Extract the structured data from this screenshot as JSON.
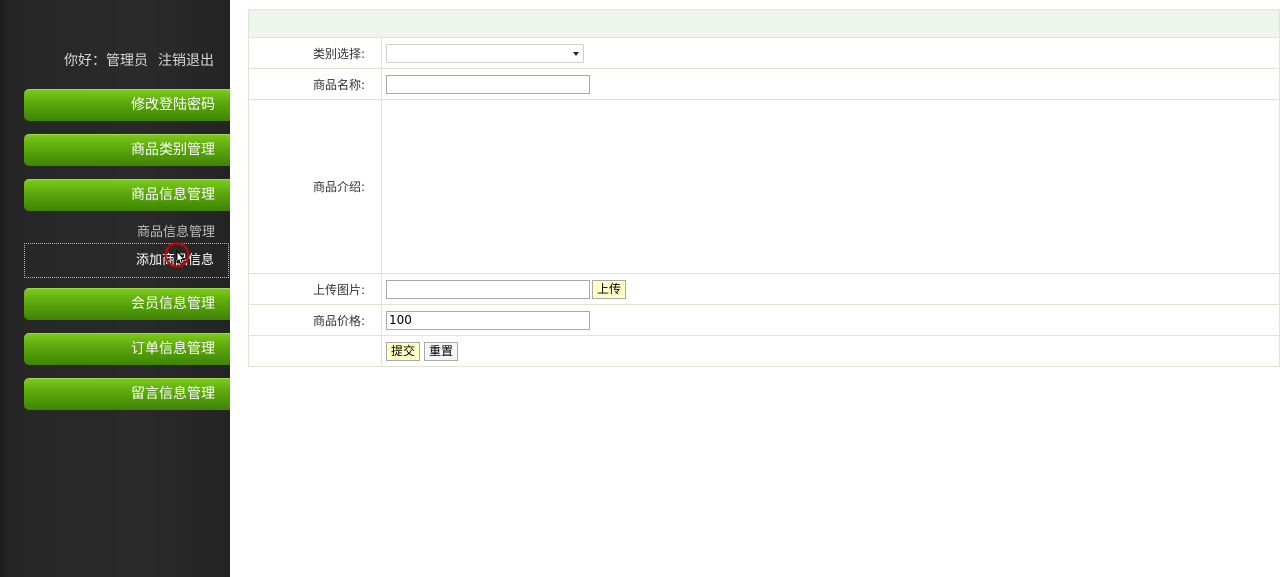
{
  "sidebar": {
    "greeting": "你好：管理员",
    "logout": "注销退出",
    "items": [
      {
        "label": "修改登陆密码"
      },
      {
        "label": "商品类别管理"
      },
      {
        "label": "商品信息管理"
      },
      {
        "label": "会员信息管理"
      },
      {
        "label": "订单信息管理"
      },
      {
        "label": "留言信息管理"
      }
    ],
    "subitems": [
      {
        "label": "商品信息管理"
      },
      {
        "label": "添加商品信息"
      }
    ]
  },
  "form": {
    "category_label": "类别选择:",
    "category_value": "",
    "name_label": "商品名称:",
    "name_value": "",
    "desc_label": "商品介绍:",
    "image_label": "上传图片:",
    "image_value": "",
    "upload_button": "上传",
    "price_label": "商品价格:",
    "price_value": "100",
    "submit_button": "提交",
    "reset_button": "重置"
  },
  "colors": {
    "sidebar_bg": "#262626",
    "nav_green": "#5aa80c",
    "header_bg": "#eef5ec",
    "border": "#dfe6cf",
    "button_yellow": "#ffffc6"
  }
}
